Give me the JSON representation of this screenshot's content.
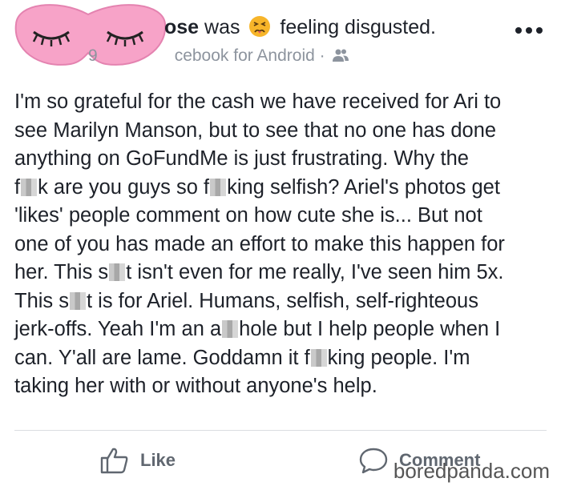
{
  "post": {
    "author_suffix": "ose",
    "was": "was",
    "feeling": "feeling disgusted.",
    "meta_prefix": "9",
    "meta_app": "cebook for Android",
    "meta_sep": "·",
    "text_lines": [
      [
        "I'm so grateful for the cash we have received for Ari to"
      ],
      [
        "see Marilyn Manson, but to see that no one has done"
      ],
      [
        "anything on GoFundMe is just frustrating. Why the"
      ],
      [
        "f",
        "#",
        "k are you guys so f",
        "#",
        "king selfish? Ariel's photos get"
      ],
      [
        "'likes' people comment on how cute she is... But not"
      ],
      [
        "one of you has made an effort to make this happen for"
      ],
      [
        "her. This s",
        "#",
        "t isn't even for me really, I've seen him 5x."
      ],
      [
        "This s",
        "#",
        "t is for Ariel. Humans, selfish, self-righteous"
      ],
      [
        "jerk-offs. Yeah I'm an a",
        "#",
        "hole but I help people when I"
      ],
      [
        "can. Y'all are lame. Goddamn it f",
        "#",
        "king people. I'm"
      ],
      [
        "taking her with or without anyone's help."
      ]
    ]
  },
  "actions": {
    "like_label": "Like",
    "comment_label": "Comment"
  },
  "watermark": "boredpanda.com",
  "colors": {
    "text": "#1d2129",
    "meta": "#8d949e",
    "action": "#606770",
    "mask": "#f7a3c8",
    "emoji": "#f7b52a"
  },
  "icons": {
    "emoji": "disgusted-face-icon",
    "audience": "friends-icon",
    "more": "more-dots-icon",
    "like": "thumbs-up-icon",
    "comment": "comment-bubble-icon"
  }
}
